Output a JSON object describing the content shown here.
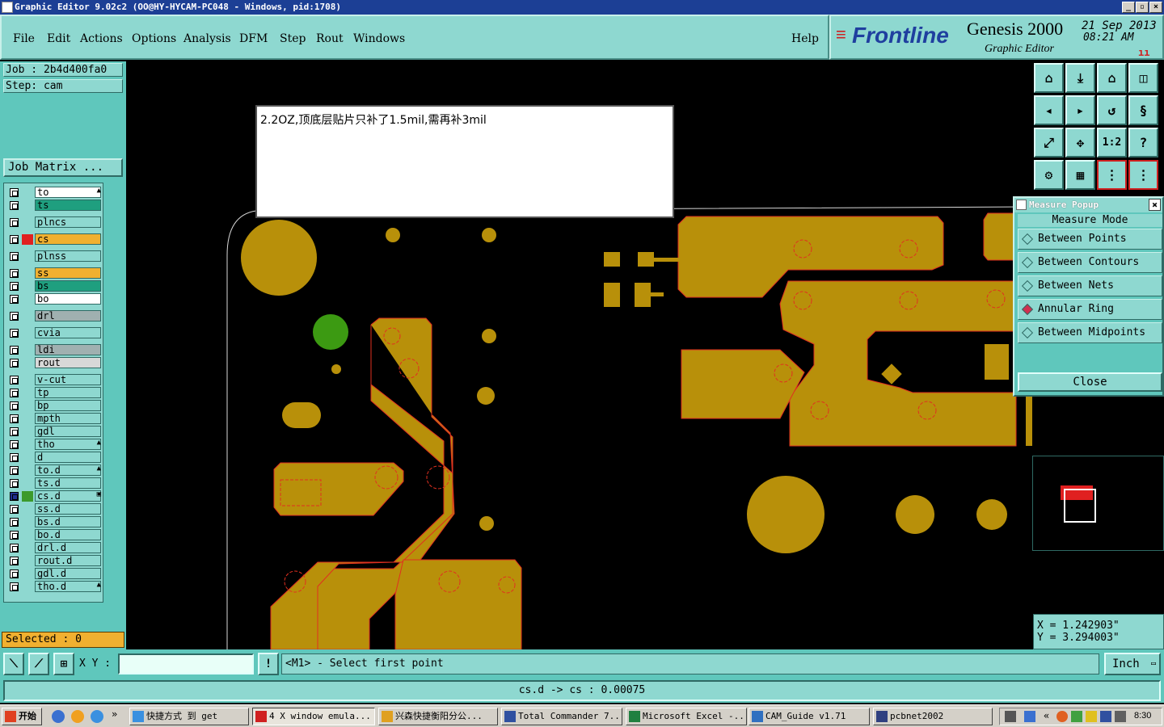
{
  "window": {
    "title": "Graphic Editor 9.02c2  (OO@HY-HYCAM-PC048 - Windows, pid:1708)"
  },
  "menu": {
    "items": [
      "File",
      "Edit",
      "Actions",
      "Options",
      "Analysis",
      "DFM",
      "Step",
      "Rout",
      "Windows"
    ],
    "help": "Help"
  },
  "brand": {
    "logo": "Frontline",
    "product": "Genesis 2000",
    "subtitle": "Graphic Editor",
    "date": "21 Sep 2013",
    "time": "08:21 AM"
  },
  "job": {
    "job_label": "Job :  2b4d400fa0",
    "step_label": "Step:  cam",
    "matrix_button": "Job Matrix ..."
  },
  "layers": [
    {
      "name": "to",
      "color": "#ffffff",
      "swatch": "",
      "mark": "▲"
    },
    {
      "name": "ts",
      "color": "#1f9f7f",
      "swatch": "",
      "mark": ""
    },
    {
      "name": "plncs",
      "color": "#8ed8d0",
      "swatch": "",
      "mark": ""
    },
    {
      "name": "cs",
      "color": "#f0b030",
      "swatch": "#e02020",
      "mark": ""
    },
    {
      "name": "plnss",
      "color": "#8ed8d0",
      "swatch": "",
      "mark": ""
    },
    {
      "name": "ss",
      "color": "#f0b030",
      "swatch": "",
      "mark": ""
    },
    {
      "name": "bs",
      "color": "#1f9f7f",
      "swatch": "",
      "mark": ""
    },
    {
      "name": "bo",
      "color": "#ffffff",
      "swatch": "",
      "mark": ""
    },
    {
      "name": "drl",
      "color": "#a0b0b0",
      "swatch": "",
      "mark": ""
    },
    {
      "name": "cvia",
      "color": "#8ed8d0",
      "swatch": "",
      "mark": ""
    },
    {
      "name": "ldi",
      "color": "#a0b0b0",
      "swatch": "",
      "mark": ""
    },
    {
      "name": "rout",
      "color": "#d8d8d8",
      "swatch": "",
      "mark": ""
    },
    {
      "name": "v-cut",
      "color": "#8ed8d0",
      "swatch": "",
      "mark": ""
    },
    {
      "name": "tp",
      "color": "#8ed8d0",
      "swatch": "",
      "mark": ""
    },
    {
      "name": "bp",
      "color": "#8ed8d0",
      "swatch": "",
      "mark": ""
    },
    {
      "name": "mpth",
      "color": "#8ed8d0",
      "swatch": "",
      "mark": ""
    },
    {
      "name": "gdl",
      "color": "#8ed8d0",
      "swatch": "",
      "mark": ""
    },
    {
      "name": "tho",
      "color": "#8ed8d0",
      "swatch": "",
      "mark": "▲"
    },
    {
      "name": "d",
      "color": "#8ed8d0",
      "swatch": "",
      "mark": ""
    },
    {
      "name": "to.d",
      "color": "#8ed8d0",
      "swatch": "",
      "mark": "▲"
    },
    {
      "name": "ts.d",
      "color": "#8ed8d0",
      "swatch": "",
      "mark": ""
    },
    {
      "name": "cs.d",
      "color": "#8ed8d0",
      "swatch": "#3c9a2c",
      "mark": "▣"
    },
    {
      "name": "ss.d",
      "color": "#8ed8d0",
      "swatch": "",
      "mark": ""
    },
    {
      "name": "bs.d",
      "color": "#8ed8d0",
      "swatch": "",
      "mark": ""
    },
    {
      "name": "bo.d",
      "color": "#8ed8d0",
      "swatch": "",
      "mark": ""
    },
    {
      "name": "drl.d",
      "color": "#8ed8d0",
      "swatch": "",
      "mark": ""
    },
    {
      "name": "rout.d",
      "color": "#8ed8d0",
      "swatch": "",
      "mark": ""
    },
    {
      "name": "gdl.d",
      "color": "#8ed8d0",
      "swatch": "",
      "mark": ""
    },
    {
      "name": "tho.d",
      "color": "#8ed8d0",
      "swatch": "",
      "mark": "▲"
    }
  ],
  "selected": "Selected : 0",
  "note": "2.2OZ,顶底层贴片只补了1.5mil,需再补3mil",
  "measure_popup": {
    "title": "Measure Popup",
    "mode_label": "Measure Mode",
    "options": [
      "Between Points",
      "Between Contours",
      "Between Nets",
      "Annular Ring",
      "Between Midpoints"
    ],
    "active_index": 3,
    "close": "Close"
  },
  "coords": {
    "x": "X = 1.242903\"",
    "y": "Y = 3.294003\""
  },
  "bottom": {
    "xy_label": "X Y :",
    "xy_value": "",
    "prompt": "<M1> - Select first point",
    "units": "Inch"
  },
  "status_line": "cs.d -> cs : 0.00075",
  "taskbar": {
    "start": "开始",
    "tasks": [
      "快捷方式 到 get",
      "4 X window emula...",
      "兴森快捷衡阳分公...",
      "Total Commander 7...",
      "Microsoft Excel -...",
      "CAM_Guide v1.71",
      "pcbnet2002"
    ],
    "clock": "8:30"
  },
  "colors": {
    "copper": "#b8900a",
    "outline": "#e03020",
    "panel": "#5fc7bc",
    "panel_light": "#8ed8d0"
  }
}
